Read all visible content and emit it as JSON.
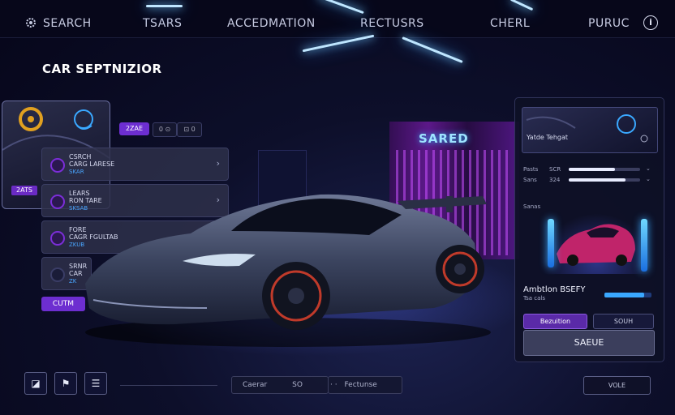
{
  "nav": {
    "items": [
      "SEARCH",
      "TSARS",
      "ACCEDMATION",
      "RECTUSRS",
      "CHERL",
      "PURUC"
    ]
  },
  "page": {
    "title": "CAR SEPTNIZIOR"
  },
  "garage": {
    "sign": "SARED"
  },
  "preview_card": {
    "tag": "2ATS"
  },
  "filters": {
    "chips": [
      "2ZAE",
      "0 ⊙",
      "⊡ 0"
    ]
  },
  "list": {
    "items": [
      {
        "line1": "CSRCH",
        "line2": "CARG LARESE",
        "line3": "SKAR"
      },
      {
        "line1": "LEARS",
        "line2": "RON TARE",
        "line3": "SKSAB"
      },
      {
        "line1": "FORE",
        "line2": "CAGR FGULTAB",
        "line3": "ZKUB"
      },
      {
        "line1": "SRNR",
        "line2": "CAR",
        "line3": "ZK"
      }
    ],
    "custom_button": "CUTM"
  },
  "right_panel": {
    "image_label": "Yatde Tehgat",
    "stats": [
      {
        "label": "Pasts",
        "value": "SCR",
        "fill": 0.65
      },
      {
        "label": "Sans",
        "value": "324",
        "fill": 0.8
      }
    ],
    "section_label": "Sanas",
    "car_name": "Ambtlon BSEFY",
    "car_sub": "Tsa cals",
    "meter_fill": 0.85,
    "primary_button": "Bezuition",
    "secondary_button": "SOUH",
    "save_button": "SAEUE"
  },
  "bottom_bar": {
    "field1_label": "Caerar",
    "field1_value": "SO",
    "field2_label": "Fectunse",
    "vote_button": "VOLE"
  },
  "colors": {
    "accent_purple": "#6d2ed0",
    "accent_blue": "#3aa8ff",
    "neon_sign": "#9fe3ff"
  }
}
